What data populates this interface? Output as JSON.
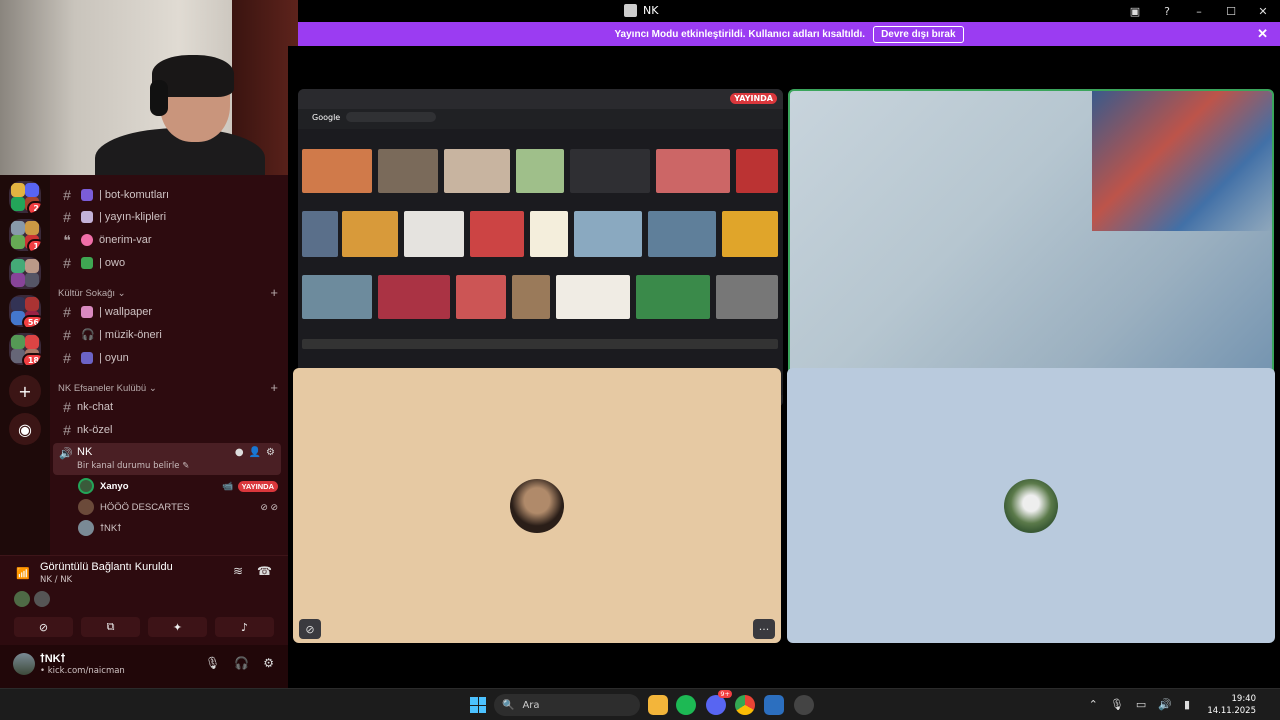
{
  "window": {
    "title": "NK",
    "mode_banner": {
      "message": "Yayıncı Modu etkinleştirildi. Kullanıcı adları kısaltıldı.",
      "disable_button": "Devre dışı bırak"
    }
  },
  "server_rail": {
    "badges": [
      "2",
      "1",
      "56",
      "18"
    ]
  },
  "channels": {
    "items": [
      {
        "emoji": "🤖",
        "label": "| bot-komutları"
      },
      {
        "emoji": "🎬",
        "label": "| yayın-klipleri"
      },
      {
        "emoji": "💗",
        "label": "önerim-var"
      },
      {
        "emoji": "🍀",
        "label": "| owo"
      }
    ],
    "category_1": {
      "label": "Kültür Sokağı",
      "items": [
        {
          "emoji": "🖼",
          "label": "| wallpaper"
        },
        {
          "label": "| müzik-öneri"
        },
        {
          "emoji": "🎮",
          "label": "| oyun"
        }
      ]
    },
    "category_2": {
      "label": "NK Efsaneler Kulübü",
      "items": [
        {
          "label": "nk-chat"
        },
        {
          "label": "nk-özel"
        }
      ]
    },
    "voice_channel": {
      "name": "NK",
      "status": "Bir kanal durumu belirle",
      "members": [
        {
          "name": "Xanyo",
          "live_badge": "YAYINDA"
        },
        {
          "name": "HÖÖÖ DESCARTES"
        },
        {
          "name": "ꝉNKꝉ"
        }
      ]
    }
  },
  "voice_panel": {
    "title": "Görüntülü Bağlantı Kuruldu",
    "subtitle": "NK / NK"
  },
  "user_panel": {
    "username": "ꝉNKꝉ",
    "status": "• kick.com/naicman"
  },
  "stage": {
    "screen_share": {
      "live_badge": "YAYINDA",
      "search_engine_label": "Google"
    }
  },
  "taskbar": {
    "search_placeholder": "Ara",
    "time": "19:40",
    "date": "14.11.2025",
    "discord_badge": "9+"
  },
  "colors": {
    "banner": "#9b3cf2",
    "sidebar": "#2d0b0f",
    "live": "#da373c",
    "speaking": "#3ba55c"
  }
}
